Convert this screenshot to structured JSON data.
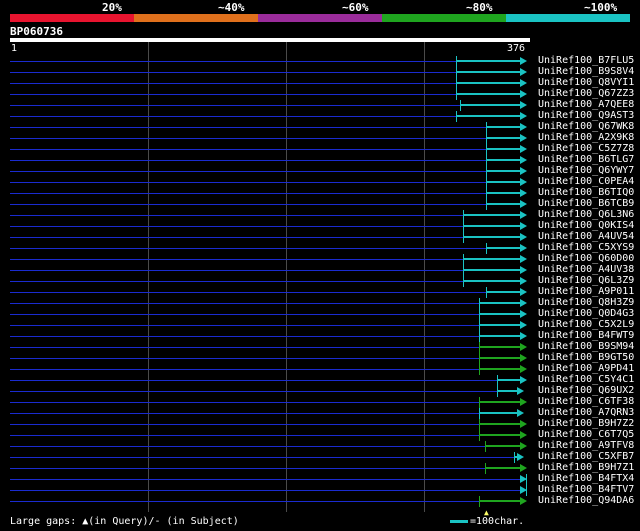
{
  "legend": {
    "labels": [
      "20%",
      "~40%",
      "~60%",
      "~80%",
      "~100%"
    ],
    "colors": [
      "#e8142f",
      "#e0701c",
      "#9b2c9b",
      "#1fa51f",
      "#1ac3c3"
    ]
  },
  "query": {
    "name": "BP060736",
    "start": "1",
    "end": "376",
    "length": 376
  },
  "hits": [
    {
      "label": "UniRef100_B7FLU5",
      "start": 325,
      "end": 376,
      "color": "#1ac3c3"
    },
    {
      "label": "UniRef100_B9S8V4",
      "start": 325,
      "end": 376,
      "color": "#1ac3c3"
    },
    {
      "label": "UniRef100_Q8VYI1",
      "start": 325,
      "end": 376,
      "color": "#1ac3c3"
    },
    {
      "label": "UniRef100_Q67ZZ3",
      "start": 325,
      "end": 376,
      "color": "#1ac3c3"
    },
    {
      "label": "UniRef100_A7QEE8",
      "start": 328,
      "end": 376,
      "color": "#1ac3c3"
    },
    {
      "label": "UniRef100_Q9AST3",
      "start": 325,
      "end": 376,
      "color": "#1ac3c3"
    },
    {
      "label": "UniRef100_Q67WK8",
      "start": 347,
      "end": 376,
      "color": "#1ac3c3"
    },
    {
      "label": "UniRef100_A2X9K8",
      "start": 347,
      "end": 376,
      "color": "#1ac3c3"
    },
    {
      "label": "UniRef100_C5Z7Z8",
      "start": 347,
      "end": 376,
      "color": "#1ac3c3"
    },
    {
      "label": "UniRef100_B6TLG7",
      "start": 347,
      "end": 376,
      "color": "#1ac3c3"
    },
    {
      "label": "UniRef100_Q6YWY7",
      "start": 347,
      "end": 376,
      "color": "#1ac3c3"
    },
    {
      "label": "UniRef100_C0PEA4",
      "start": 347,
      "end": 376,
      "color": "#1ac3c3"
    },
    {
      "label": "UniRef100_B6TIQ0",
      "start": 347,
      "end": 376,
      "color": "#1ac3c3"
    },
    {
      "label": "UniRef100_B6TCB9",
      "start": 347,
      "end": 376,
      "color": "#1ac3c3"
    },
    {
      "label": "UniRef100_Q6L3N6",
      "start": 330,
      "end": 376,
      "color": "#1ac3c3"
    },
    {
      "label": "UniRef100_Q0KIS4",
      "start": 330,
      "end": 376,
      "color": "#1ac3c3"
    },
    {
      "label": "UniRef100_A4UV54",
      "start": 330,
      "end": 376,
      "color": "#1ac3c3"
    },
    {
      "label": "UniRef100_C5XYS9",
      "start": 347,
      "end": 376,
      "color": "#1ac3c3"
    },
    {
      "label": "UniRef100_Q60D00",
      "start": 330,
      "end": 376,
      "color": "#1ac3c3"
    },
    {
      "label": "UniRef100_A4UV38",
      "start": 330,
      "end": 376,
      "color": "#1ac3c3"
    },
    {
      "label": "UniRef100_Q6L3Z9",
      "start": 330,
      "end": 376,
      "color": "#1ac3c3"
    },
    {
      "label": "UniRef100_A9P011",
      "start": 347,
      "end": 376,
      "color": "#1ac3c3"
    },
    {
      "label": "UniRef100_Q8H3Z9",
      "start": 342,
      "end": 376,
      "color": "#1ac3c3"
    },
    {
      "label": "UniRef100_Q0D4G3",
      "start": 342,
      "end": 376,
      "color": "#1ac3c3"
    },
    {
      "label": "UniRef100_C5X2L9",
      "start": 342,
      "end": 376,
      "color": "#1ac3c3"
    },
    {
      "label": "UniRef100_B4FWT9",
      "start": 342,
      "end": 376,
      "color": "#1ac3c3"
    },
    {
      "label": "UniRef100_B9SM94",
      "start": 342,
      "end": 376,
      "color": "#1fa51f"
    },
    {
      "label": "UniRef100_B9GT50",
      "start": 342,
      "end": 376,
      "color": "#1fa51f"
    },
    {
      "label": "UniRef100_A9PD41",
      "start": 342,
      "end": 376,
      "color": "#1fa51f"
    },
    {
      "label": "UniRef100_C5Y4C1",
      "start": 355,
      "end": 376,
      "color": "#1ac3c3"
    },
    {
      "label": "UniRef100_Q69UX2",
      "start": 355,
      "end": 374,
      "color": "#1ac3c3"
    },
    {
      "label": "UniRef100_C6TF38",
      "start": 342,
      "end": 376,
      "color": "#1fa51f"
    },
    {
      "label": "UniRef100_A7QRN3",
      "start": 342,
      "end": 374,
      "color": "#1ac3c3"
    },
    {
      "label": "UniRef100_B9H7Z2",
      "start": 342,
      "end": 376,
      "color": "#1fa51f"
    },
    {
      "label": "UniRef100_C6T7Q5",
      "start": 342,
      "end": 376,
      "color": "#1fa51f"
    },
    {
      "label": "UniRef100_A9TFV8",
      "start": 346,
      "end": 376,
      "color": "#1fa51f"
    },
    {
      "label": "UniRef100_C5XFB7",
      "start": 367,
      "end": 374,
      "color": "#1ac3c3"
    },
    {
      "label": "UniRef100_B9H7Z1",
      "start": 346,
      "end": 376,
      "color": "#1fa51f"
    },
    {
      "label": "UniRef100_B4FTX4",
      "start": 376,
      "end": 376,
      "color": "#1ac3c3"
    },
    {
      "label": "UniRef100_B4FTV7",
      "start": 376,
      "end": 376,
      "color": "#1ac3c3"
    },
    {
      "label": "UniRef100_Q94DA6",
      "start": 342,
      "end": 376,
      "color": "#1fa51f"
    }
  ],
  "footer": {
    "text": "Large gaps: ▲(in Query)/- (in Subject)"
  },
  "scale": {
    "text": "=100char.",
    "color": "#1ac3c3"
  }
}
